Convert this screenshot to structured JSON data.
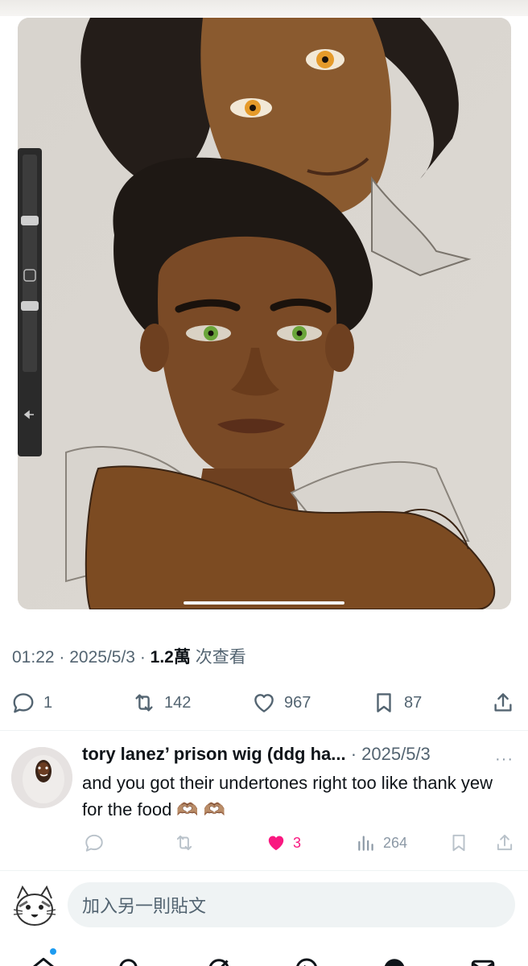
{
  "post": {
    "time": "01:22",
    "sep1": " · ",
    "date": "2025/5/3",
    "sep2": " · ",
    "views_count": "1.2萬",
    "views_label": " 次查看"
  },
  "actions": {
    "replies": "1",
    "reposts": "142",
    "likes": "967",
    "bookmarks": "87"
  },
  "reply": {
    "name": "tory lanez’ prison wig (ddg ha...",
    "date": " · 2025/5/3",
    "more": "···",
    "text": "and you got their undertones right too like thank yew for the food 🫶🏽 🫶🏽",
    "replies": "",
    "reposts": "",
    "likes": "3",
    "views": "264"
  },
  "compose": {
    "placeholder": "加入另一則貼文"
  },
  "colors": {
    "accent": "#1d9bf0",
    "like_pink": "#f91880",
    "secondary_text": "#536471"
  },
  "icons": [
    "reply-icon",
    "repost-icon",
    "like-icon",
    "bookmark-icon",
    "share-icon",
    "views-icon",
    "more-icon",
    "home-icon",
    "search-icon",
    "grok-icon",
    "spaces-icon",
    "communities-icon",
    "messages-icon"
  ]
}
